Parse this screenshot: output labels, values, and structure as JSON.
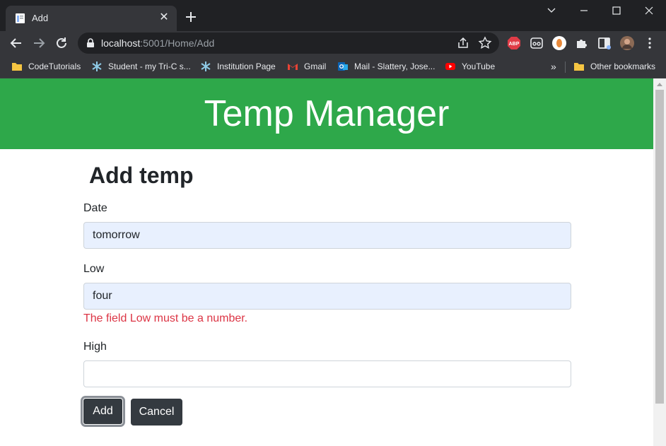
{
  "browser": {
    "tab_title": "Add",
    "url_host": "localhost",
    "url_rest": ":5001/Home/Add",
    "extensions": [
      "abp-icon",
      "reading-icon",
      "profile-ext-icon",
      "puzzle-icon",
      "sidepanel-icon",
      "avatar"
    ],
    "abp_label": "ABP"
  },
  "bookmarks": [
    {
      "label": "CodeTutorials",
      "icon": "folder-icon"
    },
    {
      "label": "Student - my Tri-C s...",
      "icon": "snowflake-icon"
    },
    {
      "label": "Institution Page",
      "icon": "snowflake-icon"
    },
    {
      "label": "Gmail",
      "icon": "gmail-icon"
    },
    {
      "label": "Mail - Slattery, Jose...",
      "icon": "outlook-icon"
    },
    {
      "label": "YouTube",
      "icon": "youtube-icon"
    }
  ],
  "bookmarks_overflow": "»",
  "other_bookmarks": "Other bookmarks",
  "page": {
    "site_title": "Temp Manager",
    "heading": "Add temp",
    "form": {
      "date_label": "Date",
      "date_value": "tomorrow",
      "low_label": "Low",
      "low_value": "four",
      "low_error": "The field Low must be a number.",
      "high_label": "High",
      "high_value": ""
    },
    "add_button": "Add",
    "cancel_button": "Cancel"
  },
  "colors": {
    "header_green": "#2ea84a",
    "button_dark": "#343a40",
    "error_red": "#dc3545",
    "autofill_blue": "#e8f0fe"
  }
}
